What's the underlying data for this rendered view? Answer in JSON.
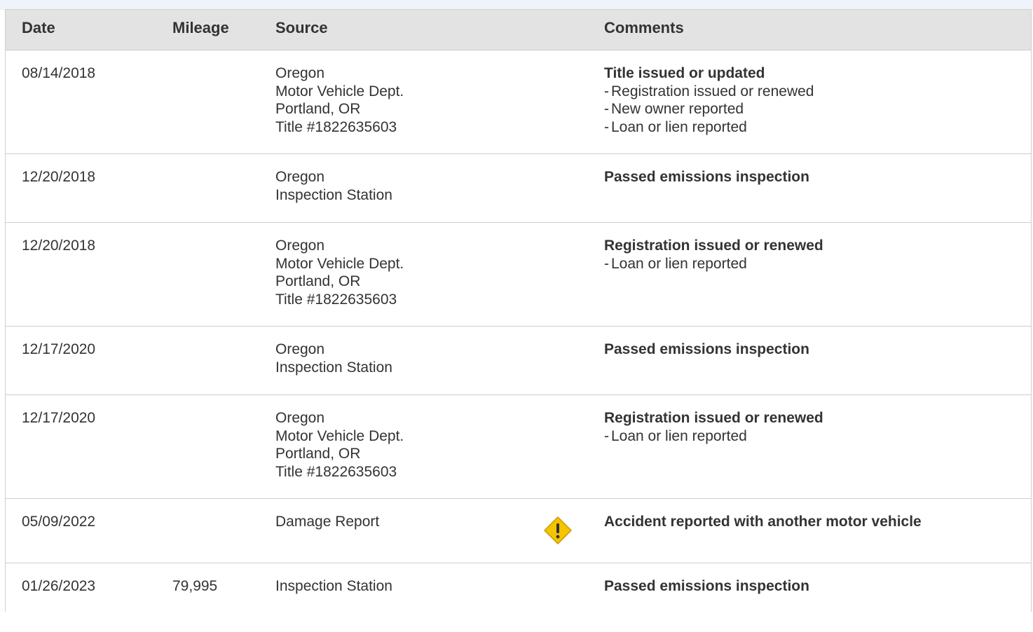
{
  "table": {
    "headers": {
      "date": "Date",
      "mileage": "Mileage",
      "source": "Source",
      "comments": "Comments"
    },
    "rows": [
      {
        "date": "08/14/2018",
        "mileage": "",
        "source": [
          "Oregon",
          "Motor Vehicle Dept.",
          "Portland, OR",
          "Title #1822635603"
        ],
        "headline": "Title issued or updated",
        "details": [
          "Registration issued or renewed",
          "New owner reported",
          "Loan or lien reported"
        ],
        "warning": false
      },
      {
        "date": "12/20/2018",
        "mileage": "",
        "source": [
          "Oregon",
          "Inspection Station"
        ],
        "headline": "Passed emissions inspection",
        "details": [],
        "warning": false
      },
      {
        "date": "12/20/2018",
        "mileage": "",
        "source": [
          "Oregon",
          "Motor Vehicle Dept.",
          "Portland, OR",
          "Title #1822635603"
        ],
        "headline": "Registration issued or renewed",
        "details": [
          "Loan or lien reported"
        ],
        "warning": false
      },
      {
        "date": "12/17/2020",
        "mileage": "",
        "source": [
          "Oregon",
          "Inspection Station"
        ],
        "headline": "Passed emissions inspection",
        "details": [],
        "warning": false
      },
      {
        "date": "12/17/2020",
        "mileage": "",
        "source": [
          "Oregon",
          "Motor Vehicle Dept.",
          "Portland, OR",
          "Title #1822635603"
        ],
        "headline": "Registration issued or renewed",
        "details": [
          "Loan or lien reported"
        ],
        "warning": false
      },
      {
        "date": "05/09/2022",
        "mileage": "",
        "source": [
          "Damage Report"
        ],
        "headline": "Accident reported with another motor vehicle",
        "details": [],
        "warning": true,
        "warning_icon": "warning-diamond-icon"
      },
      {
        "date": "01/26/2023",
        "mileage": "79,995",
        "source": [
          "Inspection Station"
        ],
        "headline": "Passed emissions inspection",
        "details": [],
        "warning": false
      }
    ]
  },
  "colors": {
    "header_bg": "#e3e3e3",
    "text": "#333333",
    "warning": "#f5c400",
    "border": "#cfcfcf",
    "top_band": "#eef4fa"
  }
}
